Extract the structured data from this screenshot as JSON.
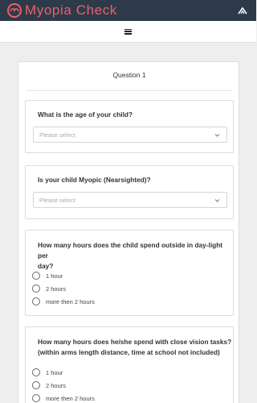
{
  "app": {
    "title": "Myopia Check"
  },
  "survey": {
    "question_heading": "Question 1",
    "cards": [
      {
        "title": "What is the age of your child?",
        "type": "select",
        "placeholder": "Please select"
      },
      {
        "title": "Is your child Myopic (Nearsighted)?",
        "type": "select",
        "placeholder": "Please select"
      },
      {
        "title_lines": [
          "How many hours does the child spend outside in day-light per",
          "day?"
        ],
        "type": "radio",
        "options": [
          "1 hour",
          "2 hours",
          "more then 2 hours"
        ]
      },
      {
        "title_lines": [
          "How many hours does he/she spend with close vision tasks?",
          "(within arms length distance, time at school not included)"
        ],
        "type": "radio",
        "options": [
          "1 hour",
          "2 hours",
          "more then 2 hours"
        ]
      }
    ]
  },
  "colors": {
    "topbar": "#2e3a4a",
    "brand": "#e8616b",
    "background": "#eeeeee"
  },
  "icons": {
    "logo": "glasses-logo-icon",
    "top_right": "chevron-up-icon",
    "menu": "hamburger-menu-icon",
    "select": "chevron-down-icon"
  }
}
